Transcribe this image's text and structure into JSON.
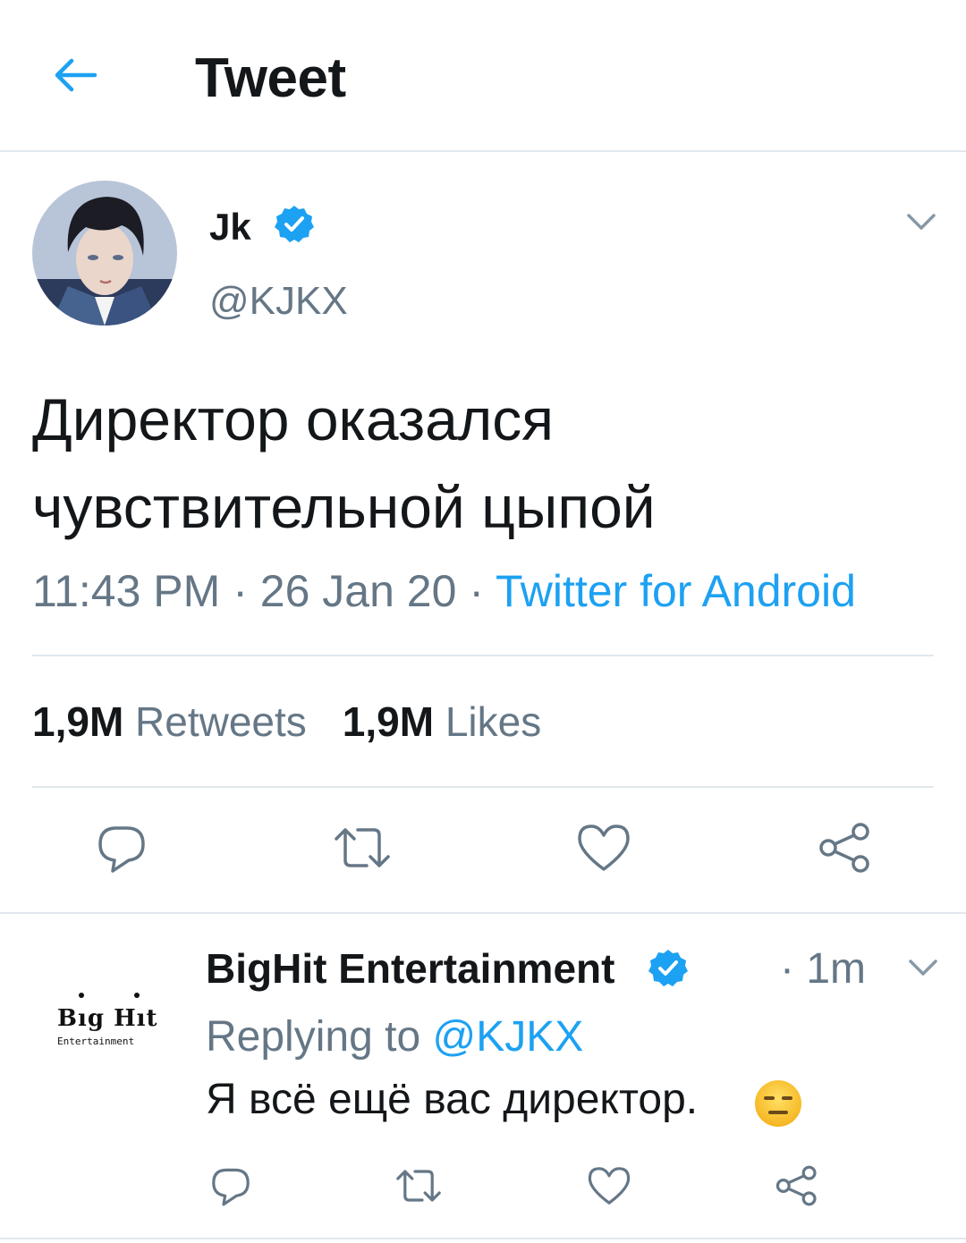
{
  "header": {
    "title": "Tweet"
  },
  "tweet": {
    "author_name": "Jk",
    "author_handle": "@KJKX",
    "text_line1": "Директор оказался",
    "text_line2": "чувствительной цыпой",
    "time": "11:43 PM",
    "date": "26 Jan 20",
    "source": "Twitter for Android",
    "retweets_count": "1,9M",
    "retweets_label": "Retweets",
    "likes_count": "1,9M",
    "likes_label": "Likes"
  },
  "reply": {
    "author_name": "BigHit Entertainment",
    "time": "· 1m",
    "replying_prefix": "Replying to",
    "replying_to": "@KJKX",
    "text": "Я всё ещё вас директор.",
    "emoji": "expressionless-face-emoji",
    "logo_text": "Bıg Hıt",
    "logo_subtext": "Entertainment"
  },
  "colors": {
    "accent": "#1da1f2",
    "secondary_text": "#657786",
    "primary_text": "#14171a",
    "divider": "#e1e8ed"
  },
  "icons": {
    "back": "arrow-left-icon",
    "verified": "verified-badge-icon",
    "caret": "chevron-down-icon",
    "reply": "reply-icon",
    "retweet": "retweet-icon",
    "like": "heart-icon",
    "share": "share-icon"
  }
}
